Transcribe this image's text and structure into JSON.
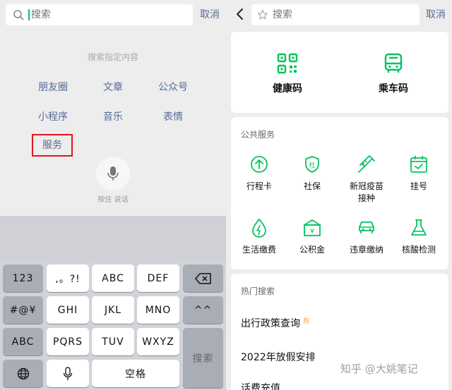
{
  "left": {
    "search_placeholder": "搜索",
    "cancel": "取消",
    "hint": "搜索指定内容",
    "categories": [
      "朋友圈",
      "文章",
      "公众号",
      "小程序",
      "音乐",
      "表情",
      "服务"
    ],
    "mic_label": "按住 说话",
    "keyboard": {
      "row1": [
        "123",
        ",。?!",
        "ABC",
        "DEF"
      ],
      "row2": [
        "#@¥",
        "GHI",
        "JKL",
        "MNO",
        "^^"
      ],
      "row3": [
        "ABC",
        "PQRS",
        "TUV",
        "WXYZ"
      ],
      "space": "空格",
      "search": "搜索"
    }
  },
  "right": {
    "search_placeholder": "搜索",
    "cancel": "取消",
    "top_items": [
      "健康码",
      "乘车码"
    ],
    "public_services_title": "公共服务",
    "services": [
      "行程卡",
      "社保",
      "新冠疫苗\n接种",
      "挂号",
      "生活缴费",
      "公积金",
      "违章缴纳",
      "核酸检测"
    ],
    "hot_title": "热门搜索",
    "hot_items": [
      "出行政策查询",
      "2022年放假安排",
      "话费充值"
    ],
    "hot_badge": "热",
    "accent": "#07c160"
  },
  "watermark": "知乎 @大姚笔记"
}
